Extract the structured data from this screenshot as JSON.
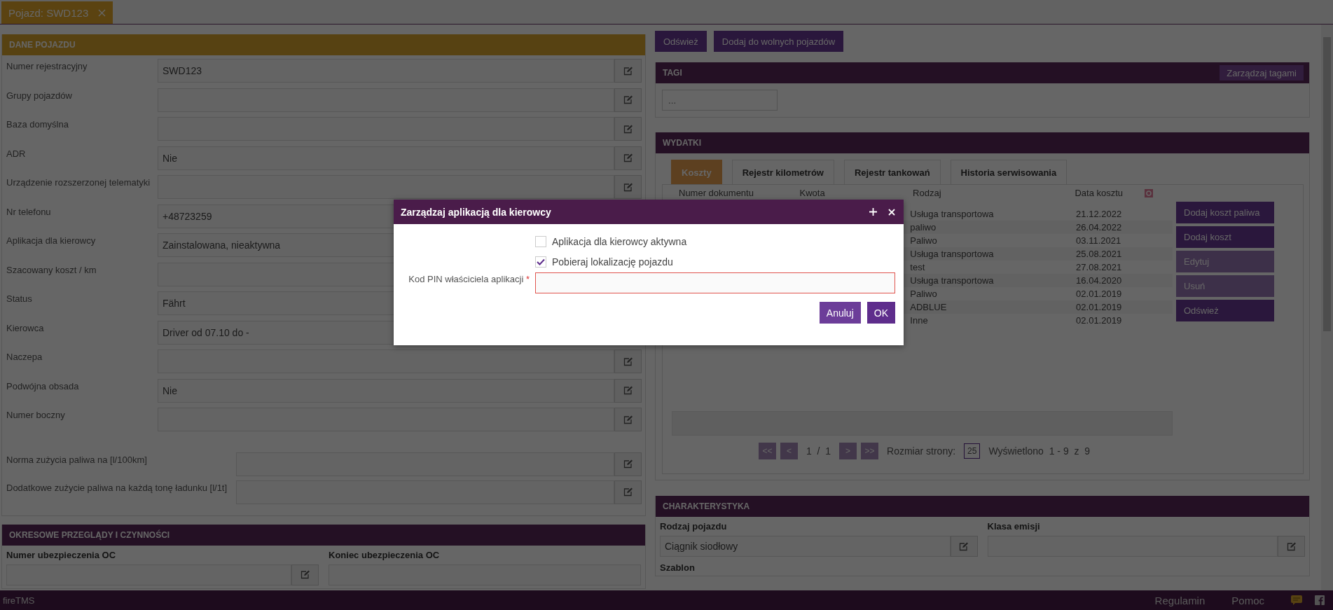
{
  "tab": {
    "label": "Pojazd: SWD123"
  },
  "vehicle_data": {
    "title": "DANE POJAZDU",
    "fields": [
      {
        "label": "Numer rejestracyjny",
        "value": "SWD123",
        "editable": true
      },
      {
        "label": "Grupy pojazdów",
        "editable": true
      },
      {
        "label": "Baza domyślna",
        "editable": true
      },
      {
        "label": "ADR",
        "value": "Nie",
        "editable": true
      },
      {
        "label": "Urządzenie rozszerzonej telematyki",
        "editable": true
      },
      {
        "label": "Nr telefonu",
        "value": "+48723259",
        "editable": false
      },
      {
        "label": "Aplikacja dla kierowcy",
        "value": "Zainstalowana, nieaktywna",
        "editable": false
      },
      {
        "label": "Szacowany koszt / km",
        "editable": false
      },
      {
        "label": "Status",
        "value": "Fährt",
        "editable": false
      },
      {
        "label": "Kierowca",
        "value": "Driver od 07.10 do  -",
        "editable": false
      },
      {
        "label": "Naczepa",
        "editable": true
      },
      {
        "label": "Podwójna obsada",
        "value": "Nie",
        "editable": true
      },
      {
        "label": "Numer boczny",
        "editable": true
      }
    ],
    "fuel_fields": [
      {
        "label": "Norma zużycia paliwa na [l/100km]"
      },
      {
        "label": "Dodatkowe zużycie paliwa na każdą tonę ładunku [l/1t]"
      }
    ]
  },
  "periodic": {
    "title": "OKRESOWE PRZEGLĄDY I CZYNNOŚCI",
    "fields": [
      {
        "label": "Numer ubezpieczenia OC",
        "editable": true
      },
      {
        "label": "Koniec ubezpieczenia OC",
        "editable": false
      }
    ]
  },
  "toolbar": [
    "Odśwież",
    "Dodaj do wolnych pojazdów"
  ],
  "tags": {
    "title": "TAGI",
    "manage_button": "Zarządzaj tagami",
    "placeholder": "..."
  },
  "expenses": {
    "title": "WYDATKI",
    "tabs": [
      {
        "label": "Koszty",
        "selected": true
      },
      {
        "label": "Rejestr kilometrów",
        "selected": false
      },
      {
        "label": "Rejestr tankowań",
        "selected": false
      },
      {
        "label": "Historia serwisowania",
        "selected": false
      }
    ],
    "columns": [
      "Numer dokumentu",
      "Kwota",
      "Rodzaj",
      "Data kosztu"
    ],
    "rows": [
      {
        "type": "Usługa transportowa",
        "date": "21.12.2022"
      },
      {
        "type": "paliwo",
        "date": "26.04.2022"
      },
      {
        "type": "Paliwo",
        "date": "03.11.2021"
      },
      {
        "type": "Usługa transportowa",
        "date": "25.08.2021"
      },
      {
        "type": "test",
        "date": "27.08.2021"
      },
      {
        "type": "Usługa transportowa",
        "date": "16.04.2020"
      },
      {
        "type": "Paliwo",
        "date": "02.01.2019"
      },
      {
        "type": "ADBLUE",
        "date": "02.01.2019"
      },
      {
        "type": "Inne",
        "date": "02.01.2019"
      }
    ],
    "actions": [
      {
        "label": "Dodaj koszt paliwa",
        "disabled": false
      },
      {
        "label": "Dodaj koszt",
        "disabled": false
      },
      {
        "label": "Edytuj",
        "disabled": true
      },
      {
        "label": "Usuń",
        "disabled": true
      },
      {
        "label": "Odśwież",
        "disabled": false
      }
    ],
    "pagination": {
      "first": "<<",
      "prev": "<",
      "page": "1  /  1",
      "next": ">",
      "last": ">>",
      "page_size_label": "Rozmiar strony:",
      "page_size": "25",
      "summary": "Wyświetlono  1 - 9  z  9"
    }
  },
  "characteristics": {
    "title": "CHARAKTERYSTYKA",
    "fields": [
      {
        "label": "Rodzaj pojazdu",
        "value": "Ciągnik siodłowy",
        "editable": true
      },
      {
        "label": "Klasa emisji",
        "editable": true
      }
    ],
    "next_label": "Szablon"
  },
  "footer": {
    "brand": "fireTMS",
    "links": [
      "Regulamin",
      "Pomoc"
    ]
  },
  "dialog": {
    "title": "Zarządzaj aplikacją dla kierowcy",
    "options": [
      {
        "label": "Aplikacja dla kierowcy aktywna",
        "checked": false
      },
      {
        "label": "Pobieraj lokalizację pojazdu",
        "checked": true
      }
    ],
    "pin_label": "Kod PIN właściciela aplikacji",
    "required_mark": "*",
    "buttons": [
      "Anuluj",
      "OK"
    ]
  }
}
